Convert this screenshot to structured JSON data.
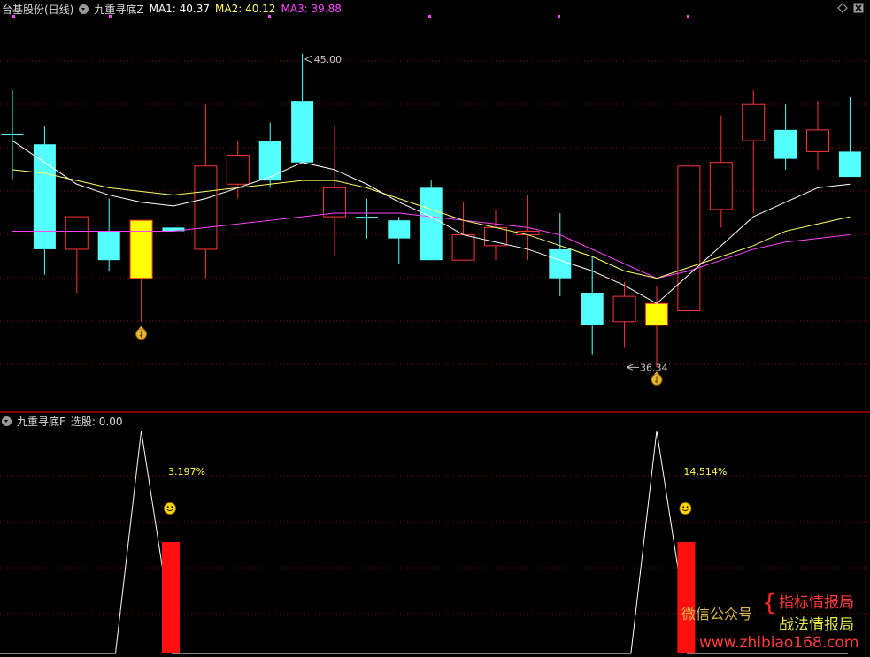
{
  "header": {
    "stock_name": "台基股份(日线)",
    "indicator_name": "九重寻底Z",
    "ma1_label": "MA1: 40.37",
    "ma2_label": "MA2: 40.12",
    "ma3_label": "MA3: 39.88"
  },
  "sub_header": {
    "indicator_name": "九重寻底F",
    "select_label": "选股: 0.00"
  },
  "watermark": {
    "left_text": "微信公众号",
    "right_line1": "指标情报局",
    "right_line2": "战法情报局",
    "url": "www.zhibiao168.com"
  },
  "colors": {
    "up": "#ff3232",
    "down": "#54ffff",
    "signal": "#ffff00",
    "ma1": "#ffffff",
    "ma2": "#ffff66",
    "ma3": "#ff44ff",
    "grid": "#7a1010",
    "divider": "#b00000"
  },
  "chart_data": [
    {
      "type": "candlestick",
      "title": "九重寻底Z",
      "candles": [
        {
          "o": 42.8,
          "h": 44.0,
          "l": 41.5,
          "c": 42.8,
          "dir": "down"
        },
        {
          "o": 42.5,
          "h": 43.0,
          "l": 38.9,
          "c": 39.6,
          "dir": "down"
        },
        {
          "o": 39.6,
          "h": 40.3,
          "l": 38.4,
          "c": 40.5,
          "dir": "up"
        },
        {
          "o": 40.1,
          "h": 41.0,
          "l": 39.0,
          "c": 39.3,
          "dir": "down"
        },
        {
          "o": 40.4,
          "h": 40.4,
          "l": 37.6,
          "c": 38.8,
          "dir": "signal"
        },
        {
          "o": 40.2,
          "h": 40.2,
          "l": 40.1,
          "c": 40.1,
          "dir": "down"
        },
        {
          "o": 39.6,
          "h": 43.6,
          "l": 38.8,
          "c": 41.9,
          "dir": "up"
        },
        {
          "o": 41.4,
          "h": 42.6,
          "l": 41.0,
          "c": 42.2,
          "dir": "up"
        },
        {
          "o": 42.6,
          "h": 43.1,
          "l": 41.3,
          "c": 41.5,
          "dir": "down"
        },
        {
          "o": 43.7,
          "h": 45.0,
          "l": 42.0,
          "c": 42.0,
          "dir": "down"
        },
        {
          "o": 40.5,
          "h": 43.0,
          "l": 39.4,
          "c": 41.3,
          "dir": "up"
        },
        {
          "o": 40.5,
          "h": 41.0,
          "l": 39.9,
          "c": 40.5,
          "dir": "down"
        },
        {
          "o": 40.4,
          "h": 40.5,
          "l": 39.2,
          "c": 39.9,
          "dir": "down"
        },
        {
          "o": 41.3,
          "h": 41.5,
          "l": 39.3,
          "c": 39.3,
          "dir": "down"
        },
        {
          "o": 39.3,
          "h": 40.9,
          "l": 39.3,
          "c": 40.0,
          "dir": "up"
        },
        {
          "o": 39.7,
          "h": 40.7,
          "l": 39.3,
          "c": 40.2,
          "dir": "up"
        },
        {
          "o": 40.0,
          "h": 41.1,
          "l": 39.3,
          "c": 40.1,
          "dir": "up"
        },
        {
          "o": 39.6,
          "h": 40.6,
          "l": 38.3,
          "c": 38.8,
          "dir": "down"
        },
        {
          "o": 38.4,
          "h": 39.4,
          "l": 36.7,
          "c": 37.5,
          "dir": "down"
        },
        {
          "o": 37.6,
          "h": 38.7,
          "l": 36.9,
          "c": 38.3,
          "dir": "up"
        },
        {
          "o": 38.1,
          "h": 38.6,
          "l": 36.34,
          "c": 37.5,
          "dir": "signal"
        },
        {
          "o": 37.9,
          "h": 42.1,
          "l": 37.7,
          "c": 41.9,
          "dir": "up"
        },
        {
          "o": 40.7,
          "h": 43.3,
          "l": 40.2,
          "c": 42.0,
          "dir": "up"
        },
        {
          "o": 42.6,
          "h": 44.0,
          "l": 40.6,
          "c": 43.6,
          "dir": "up"
        },
        {
          "o": 42.9,
          "h": 43.6,
          "l": 41.8,
          "c": 42.1,
          "dir": "down"
        },
        {
          "o": 42.9,
          "h": 43.7,
          "l": 41.8,
          "c": 42.3,
          "dir": "up"
        },
        {
          "o": 42.3,
          "h": 43.8,
          "l": 42.0,
          "c": 41.6,
          "dir": "down"
        }
      ],
      "ma1": [
        42.6,
        42.0,
        41.4,
        41.1,
        40.9,
        40.8,
        41.0,
        41.3,
        41.6,
        42.0,
        41.8,
        41.4,
        40.9,
        40.5,
        40.0,
        39.8,
        39.6,
        39.3,
        39.0,
        38.6,
        38.1,
        38.9,
        39.7,
        40.5,
        40.9,
        41.3,
        41.4
      ],
      "ma2": [
        41.8,
        41.7,
        41.5,
        41.3,
        41.2,
        41.1,
        41.2,
        41.3,
        41.4,
        41.5,
        41.5,
        41.3,
        41.0,
        40.7,
        40.4,
        40.2,
        40.0,
        39.7,
        39.4,
        39.0,
        38.8,
        39.1,
        39.4,
        39.7,
        40.1,
        40.3,
        40.5
      ],
      "ma3": [
        40.1,
        40.1,
        40.1,
        40.1,
        40.1,
        40.1,
        40.2,
        40.3,
        40.4,
        40.5,
        40.6,
        40.6,
        40.6,
        40.5,
        40.4,
        40.3,
        40.2,
        40.0,
        39.6,
        39.2,
        38.8,
        39.0,
        39.3,
        39.6,
        39.8,
        39.9,
        40.0
      ],
      "max_label": "45.00",
      "min_label": "36.34",
      "ylim": [
        35.2,
        46.0
      ]
    },
    {
      "type": "line",
      "title": "九重寻底F",
      "peaks": [
        {
          "left": 3.2,
          "index": 4,
          "right": 4.8
        },
        {
          "left": 19.2,
          "index": 20,
          "right": 20.8
        }
      ],
      "bars": [
        {
          "index": 5,
          "value": 0.5,
          "label": "3.197%"
        },
        {
          "index": 21,
          "value": 0.5,
          "label": "14.514%"
        }
      ],
      "ylim": [
        0,
        1
      ]
    }
  ]
}
